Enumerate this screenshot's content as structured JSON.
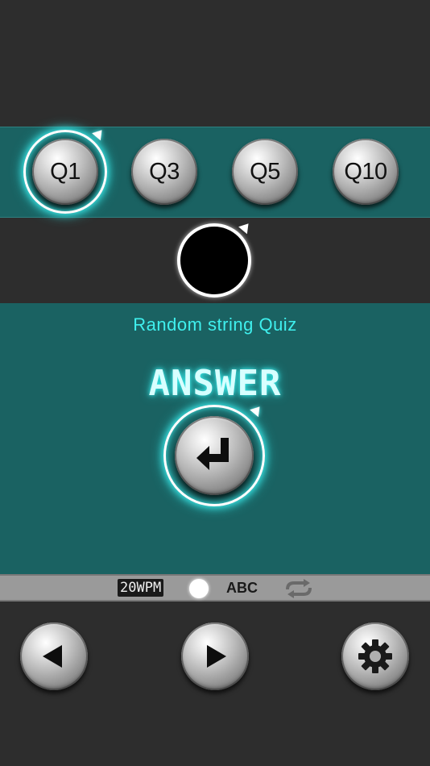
{
  "quiz_buttons": [
    {
      "label": "Q1",
      "selected": true
    },
    {
      "label": "Q3",
      "selected": false
    },
    {
      "label": "Q5",
      "selected": false
    },
    {
      "label": "Q10",
      "selected": false
    }
  ],
  "quiz": {
    "title": "Random string Quiz",
    "answer_label": "ANSWER"
  },
  "status_bar": {
    "wpm": "20WPM",
    "mode": "ABC",
    "dot_icon": "circle-indicator-icon",
    "repeat_icon": "repeat-icon"
  },
  "nav": {
    "prev_icon": "previous-icon",
    "play_icon": "play-icon",
    "settings_icon": "gear-icon"
  },
  "colors": {
    "teal_band": "#1a6262",
    "dark_band": "#2d2d2d",
    "glow": "#3ff3f3",
    "status_bar": "#9a9a9a"
  }
}
